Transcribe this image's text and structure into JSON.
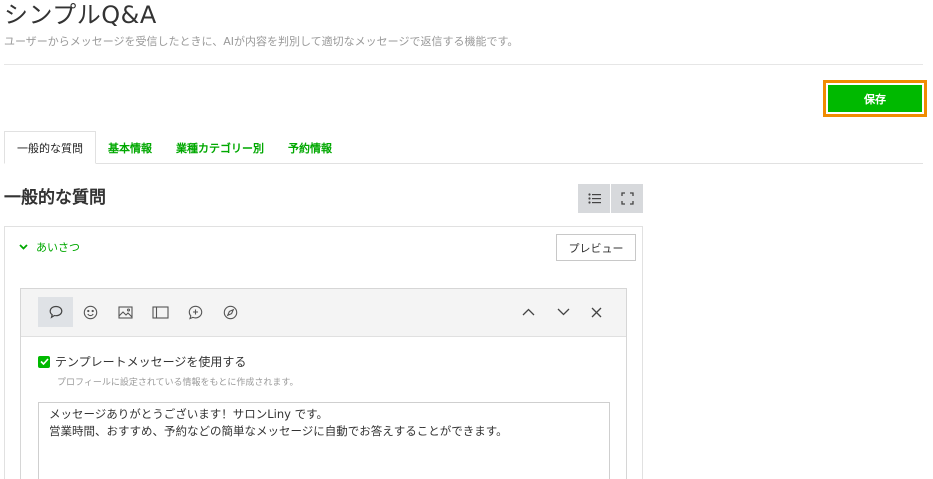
{
  "page": {
    "title": "シンプルQ&A",
    "description": "ユーザーからメッセージを受信したときに、AIが内容を判別して適切なメッセージで返信する機能です。"
  },
  "toolbar": {
    "save_label": "保存"
  },
  "tabs": [
    {
      "label": "一般的な質問",
      "active": true
    },
    {
      "label": "基本情報",
      "active": false
    },
    {
      "label": "業種カテゴリー別",
      "active": false
    },
    {
      "label": "予約情報",
      "active": false
    }
  ],
  "section": {
    "title": "一般的な質問",
    "view_icons": [
      "list-view-icon",
      "fullscreen-icon"
    ]
  },
  "qa_item": {
    "label": "あいさつ",
    "expanded": true,
    "preview_label": "プレビュー"
  },
  "editor": {
    "tools": [
      "text-bubble-icon",
      "emoji-icon",
      "image-icon",
      "card-icon",
      "add-bubble-icon",
      "compass-icon"
    ],
    "active_tool": "text-bubble-icon",
    "controls": [
      "chevron-up-icon",
      "chevron-down-icon",
      "close-icon"
    ],
    "template_checkbox_label": "テンプレートメッセージを使用する",
    "template_checked": true,
    "template_hint": "プロフィールに設定されている情報をもとに作成されます。",
    "message_lines": [
      "メッセージありがとうございます！サロンLiny です。",
      "営業時間、おすすめ、予約などの簡単なメッセージに自動でお答えすることができます。"
    ]
  },
  "colors": {
    "accent_green": "#00b900",
    "tab_green": "#00a800",
    "highlight_orange": "#f08c00"
  }
}
